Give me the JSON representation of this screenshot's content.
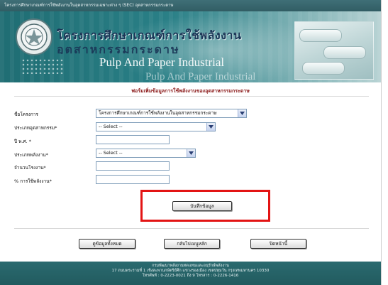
{
  "topbar": {
    "text": "โครงการศึกษาเกณฑ์การใช้พลังงานในอุตสาหกรรมเฉพาะต่าง ๆ (SEC) อุตสาหกรรมกระดาษ"
  },
  "banner": {
    "title_th_line1": "โครงการศึกษาเกณฑ์การใช้พลังงาน",
    "title_th_line2": "อุตสาหกรรมกระดาษ",
    "title_en_line1": "Pulp And Paper Industrial",
    "title_en_line2": "Pulp And Paper Industrial"
  },
  "form": {
    "heading": "ฟอร์มเพิ่มข้อมูลการใช้พลังงานของอุตสาหกรรมกระดาษ",
    "project_label": "ชื่อโครงการ",
    "project_value": "โครงการศึกษาเกณฑ์การใช้พลังงานในอุตสาหกรรมกระดาษ",
    "industry_type_label": "ประเภทอุตสาหกรรม*",
    "industry_type_value": "-- Select --",
    "year_label": "ปี พ.ศ. *",
    "year_value": "",
    "energy_type_label": "ประเภทพลังงาน*",
    "energy_type_value": "-- Select --",
    "factory_count_label": "จำนวนโรงงาน*",
    "factory_count_value": "",
    "energy_percent_label": "% การใช้พลังงาน*",
    "energy_percent_value": "",
    "save_button": "บันทึกข้อมูล"
  },
  "actions": {
    "view_all": "ดูข้อมูลทั้งหมด",
    "back_main": "กลับไปเมนูหลัก",
    "close_page": "ปิดหน้านี้"
  },
  "footer": {
    "line1": "กรมพัฒนาพลังงานทดแทนและอนุรักษ์พลังงาน",
    "line2": "17 ถนนพระรามที่ 1 เชิงสะพานกษัตริย์ศึก แขวงรองเมือง เขตปทุมวัน กรุงเทพมหานคร 10330",
    "line3": "โทรศัพท์ : 0-2223-0021 ถึง 9 โทรสาร : 0-2226-1416"
  },
  "colors": {
    "heading_red": "#8b1a1a",
    "highlight_red": "#e31414",
    "banner_teal": "#2a8087",
    "footer_teal": "#225b5f"
  },
  "icons": {
    "seal": "emblem-seal",
    "dropdown": "chevron-down-icon"
  }
}
